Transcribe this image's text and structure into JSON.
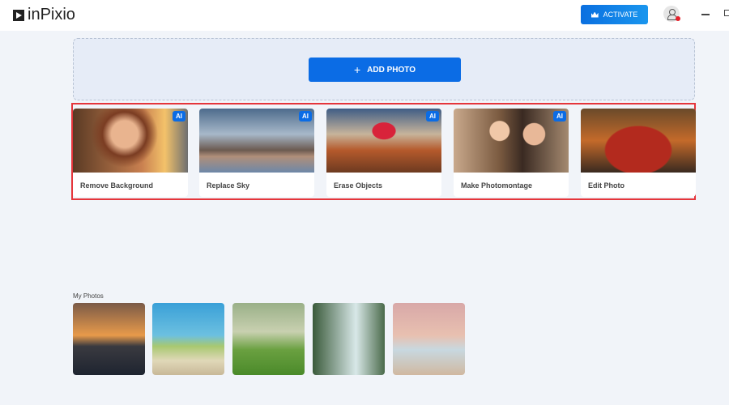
{
  "app": {
    "name": "inPixio",
    "activate_label": "ACTIVATE"
  },
  "upload": {
    "add_photo_label": "ADD PHOTO"
  },
  "tools": [
    {
      "label": "Remove Background",
      "badge": "AI"
    },
    {
      "label": "Replace Sky",
      "badge": "AI"
    },
    {
      "label": "Erase Objects",
      "badge": "AI"
    },
    {
      "label": "Make Photomontage",
      "badge": "AI"
    },
    {
      "label": "Edit Photo"
    }
  ],
  "my_photos": {
    "title": "My Photos"
  }
}
